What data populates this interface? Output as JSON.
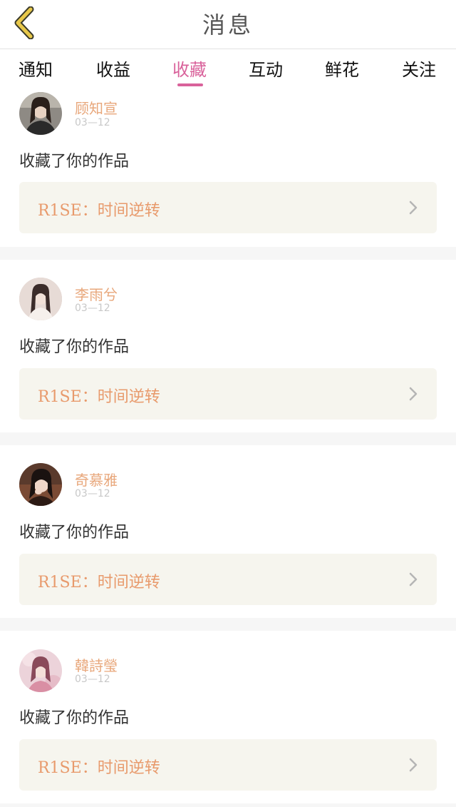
{
  "header": {
    "title": "消息",
    "back_icon": "chevron-left-icon",
    "back_icon_color": "#e8c84a"
  },
  "tabs": [
    {
      "label": "通知",
      "active": false
    },
    {
      "label": "收益",
      "active": false
    },
    {
      "label": "收藏",
      "active": true
    },
    {
      "label": "互动",
      "active": false
    },
    {
      "label": "鲜花",
      "active": false
    },
    {
      "label": "关注",
      "active": false
    }
  ],
  "colors": {
    "accent": "#d9629b",
    "username": "#e8a77b",
    "work_title": "#e89a6c",
    "work_box_bg": "#f6f5ee"
  },
  "messages": [
    {
      "username": "顾知宣",
      "date": "03—12",
      "action": "收藏了你的作品",
      "work_title": "R1SE：时间逆转",
      "avatar": "avatar-photo"
    },
    {
      "username": "李雨兮",
      "date": "03—12",
      "action": "收藏了你的作品",
      "work_title": "R1SE：时间逆转",
      "avatar": "avatar-photo"
    },
    {
      "username": "奇慕雅",
      "date": "03—12",
      "action": "收藏了你的作品",
      "work_title": "R1SE：时间逆转",
      "avatar": "avatar-photo"
    },
    {
      "username": "韓詩瑩",
      "date": "03—12",
      "action": "收藏了你的作品",
      "work_title": "R1SE：时间逆转",
      "avatar": "avatar-photo"
    }
  ]
}
